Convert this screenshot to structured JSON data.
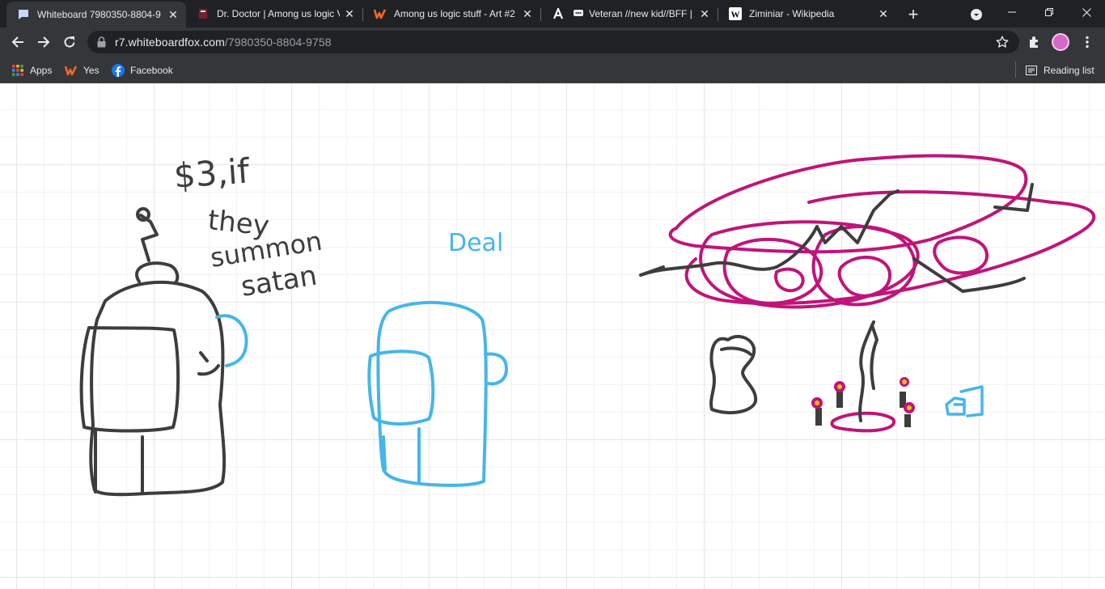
{
  "browser": {
    "tabs": [
      {
        "title": "Whiteboard 7980350-8804-9",
        "favicon": "whiteboard-fox-icon",
        "active": true
      },
      {
        "title": "Dr. Doctor | Among us logic V",
        "favicon": "wattpad-book-icon",
        "active": false
      },
      {
        "title": "Among us logic stuff - Art #2",
        "favicon": "wattpad-icon",
        "active": false
      },
      {
        "title": "Veteran //new kid//BFF | A",
        "favicon": "amino-icon",
        "active": false
      },
      {
        "title": "Ziminiar - Wikipedia",
        "favicon": "wikipedia-icon",
        "active": false
      }
    ],
    "new_tab_label": "+",
    "address": {
      "host": "r7.whiteboardfox.com",
      "path": "/7980350-8804-9758"
    },
    "bookmarks": [
      {
        "label": "Apps",
        "icon": "apps-grid-icon"
      },
      {
        "label": "Yes",
        "icon": "wattpad-icon"
      },
      {
        "label": "Facebook",
        "icon": "facebook-icon"
      }
    ],
    "reading_list_label": "Reading list"
  },
  "whiteboard": {
    "texts": {
      "price_line1": "$3,if",
      "price_line2": "they",
      "price_line3": "summon",
      "price_line4": "satan",
      "reply": "Deal"
    },
    "colors": {
      "dark_ink": "#3d3d3d",
      "blue_ink": "#45b6e8",
      "magenta_ink": "#c0147a",
      "flame": "#e8c01c"
    }
  }
}
